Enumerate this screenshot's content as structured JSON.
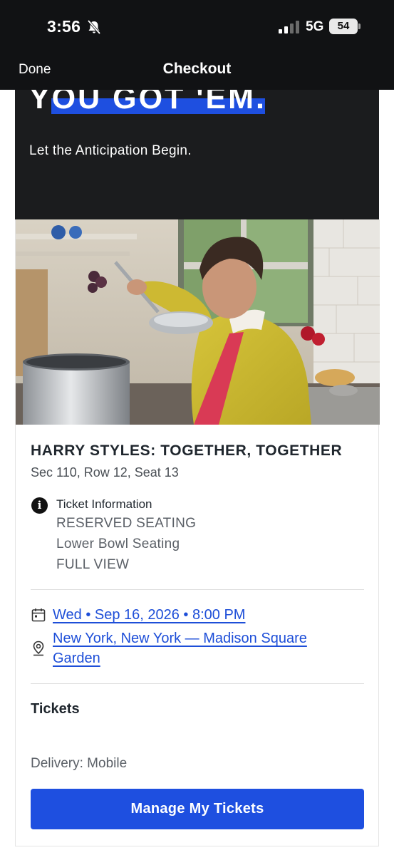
{
  "status_bar": {
    "time": "3:56",
    "network": "5G",
    "battery": "54",
    "icons": [
      "bell-slash-icon",
      "signal-icon",
      "battery-icon"
    ]
  },
  "nav": {
    "done_label": "Done",
    "title": "Checkout"
  },
  "hero": {
    "headline": "YOU GOT 'EM.",
    "subtitle": "Let the Anticipation Begin.",
    "accent_color": "#1e4fe0"
  },
  "event": {
    "title": "HARRY STYLES: TOGETHER, TOGETHER",
    "seat": "Sec 110, Row 12, Seat 13",
    "ticket_info": {
      "label": "Ticket Information",
      "lines": [
        "RESERVED SEATING",
        "Lower Bowl Seating",
        "FULL VIEW"
      ]
    },
    "date": "Wed • Sep 16, 2026 • 8:00 PM",
    "venue": "New York, New York — Madison Square Garden"
  },
  "tickets": {
    "label": "Tickets",
    "delivery": "Delivery: Mobile",
    "manage_button": "Manage My Tickets"
  },
  "colors": {
    "link": "#1d4ed8",
    "button": "#1e4fe0"
  }
}
